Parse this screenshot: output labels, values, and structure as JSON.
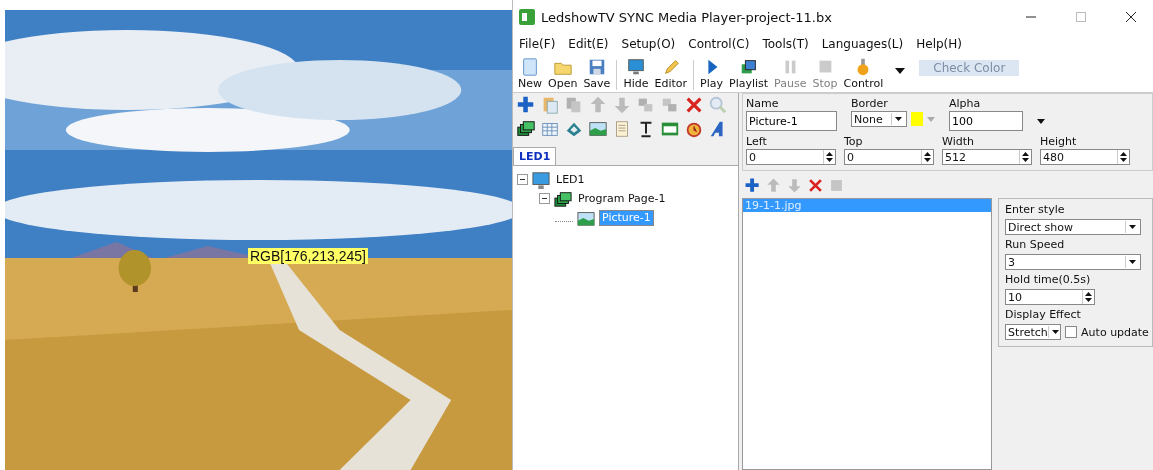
{
  "preview": {
    "color_readout": "RGB[176,213,245]"
  },
  "window": {
    "title": "LedshowTV SYNC Media Player-project-11.bx",
    "controls": [
      {
        "kind": "minimize",
        "disabled": false
      },
      {
        "kind": "maximize",
        "disabled": true
      },
      {
        "kind": "close",
        "disabled": false
      }
    ]
  },
  "menu": [
    "File(F)",
    "Edit(E)",
    "Setup(O)",
    "Control(C)",
    "Tools(T)",
    "Languages(L)",
    "Help(H)"
  ],
  "toolbar": [
    {
      "kind": "new",
      "label": "New",
      "disabled": false
    },
    {
      "kind": "open",
      "label": "Open",
      "disabled": false
    },
    {
      "kind": "save",
      "label": "Save",
      "disabled": false
    },
    {
      "kind": "hide",
      "label": "Hide",
      "disabled": false
    },
    {
      "kind": "editor",
      "label": "Editor",
      "disabled": false
    },
    {
      "kind": "play",
      "label": "Play",
      "disabled": false
    },
    {
      "kind": "playlist",
      "label": "Playlist",
      "disabled": false
    },
    {
      "kind": "pause",
      "label": "Pause",
      "disabled": true
    },
    {
      "kind": "stop",
      "label": "Stop",
      "disabled": true
    },
    {
      "kind": "control",
      "label": "Control",
      "disabled": false
    }
  ],
  "tooltip": "Check Color",
  "object_tools": [
    {
      "kind": "add",
      "disabled": false
    },
    {
      "kind": "paste",
      "disabled": false
    },
    {
      "kind": "copy",
      "disabled": true
    },
    {
      "kind": "up",
      "disabled": true
    },
    {
      "kind": "down",
      "disabled": true
    },
    {
      "kind": "back",
      "disabled": true
    },
    {
      "kind": "front",
      "disabled": true
    },
    {
      "kind": "delete",
      "disabled": false
    },
    {
      "kind": "zoom",
      "disabled": true
    }
  ],
  "add_tools": [
    {
      "kind": "layers"
    },
    {
      "kind": "table"
    },
    {
      "kind": "flash"
    },
    {
      "kind": "picture"
    },
    {
      "kind": "document"
    },
    {
      "kind": "text"
    },
    {
      "kind": "clock"
    },
    {
      "kind": "alarm"
    },
    {
      "kind": "art"
    }
  ],
  "screen_tabs": [
    {
      "label": "LED1",
      "selected": true
    }
  ],
  "tree": [
    {
      "label": "LED1",
      "kind": "screen",
      "expanded": true,
      "selected": false,
      "children": [
        {
          "label": "Program Page-1",
          "kind": "page",
          "expanded": true,
          "selected": false,
          "children": [
            {
              "label": "Picture-1",
              "kind": "picture",
              "selected": true
            }
          ]
        }
      ]
    }
  ],
  "properties": {
    "name": {
      "label": "Name",
      "value": "Picture-1"
    },
    "border": {
      "label": "Border",
      "value": "None",
      "color": "#ffff00"
    },
    "alpha": {
      "label": "Alpha",
      "value": "100"
    },
    "left": {
      "label": "Left",
      "value": "0"
    },
    "top": {
      "label": "Top",
      "value": "0"
    },
    "width": {
      "label": "Width",
      "value": "512"
    },
    "height": {
      "label": "Height",
      "value": "480"
    }
  },
  "file_tools": [
    {
      "kind": "add",
      "disabled": false
    },
    {
      "kind": "up",
      "disabled": true
    },
    {
      "kind": "down",
      "disabled": true
    },
    {
      "kind": "delete",
      "disabled": false
    },
    {
      "kind": "square",
      "disabled": true
    }
  ],
  "files": [
    {
      "name": "19-1-1.jpg",
      "selected": true
    }
  ],
  "effects": {
    "enter_style": {
      "label": "Enter style",
      "value": "Direct show"
    },
    "run_speed": {
      "label": "Run Speed",
      "value": "3"
    },
    "hold_time": {
      "label": "Hold time(0.5s)",
      "value": "10"
    },
    "display_effect": {
      "label": "Display Effect",
      "value": "Stretch"
    },
    "auto_update": {
      "label": "Auto update",
      "checked": false
    }
  }
}
